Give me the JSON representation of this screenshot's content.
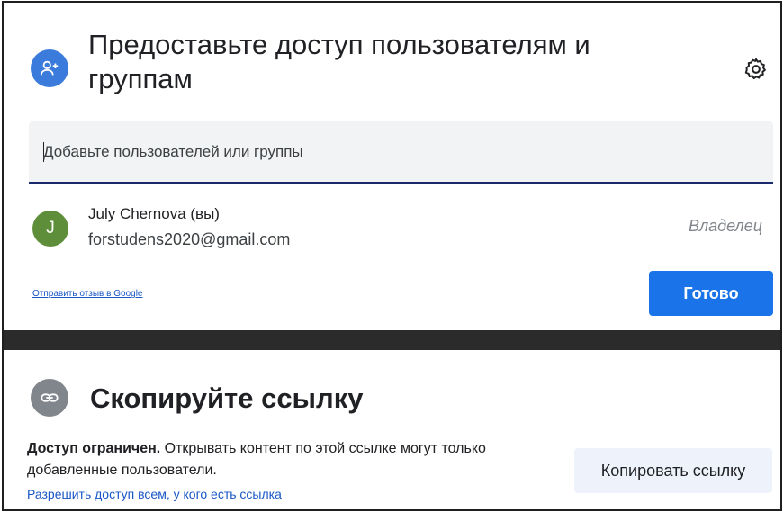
{
  "share": {
    "title": "Предоставьте доступ пользователям и группам",
    "icons": {
      "add_person": "person-add-icon",
      "settings": "gear-icon"
    },
    "input": {
      "value": "",
      "placeholder": "Добавьте пользователей или группы"
    },
    "user": {
      "initial": "J",
      "name": "July Chernova (вы)",
      "email": "forstudens2020@gmail.com",
      "role": "Владелец",
      "avatar_color": "#5e8e3a"
    },
    "feedback_link": "Отправить отзыв в Google",
    "done_label": "Готово"
  },
  "link": {
    "title": "Скопируйте ссылку",
    "icon": "link-icon",
    "access_bold": "Доступ ограничен.",
    "access_rest": " Открывать контент по этой ссылке могут только добавленные пользователи.",
    "allow_link": "Разрешить доступ всем, у кого есть ссылка",
    "copy_label": "Копировать ссылку"
  },
  "colors": {
    "primary": "#1a73e8",
    "link": "#1a57c6",
    "share_avatar": "#3b7bdb",
    "link_avatar": "#80868b"
  }
}
